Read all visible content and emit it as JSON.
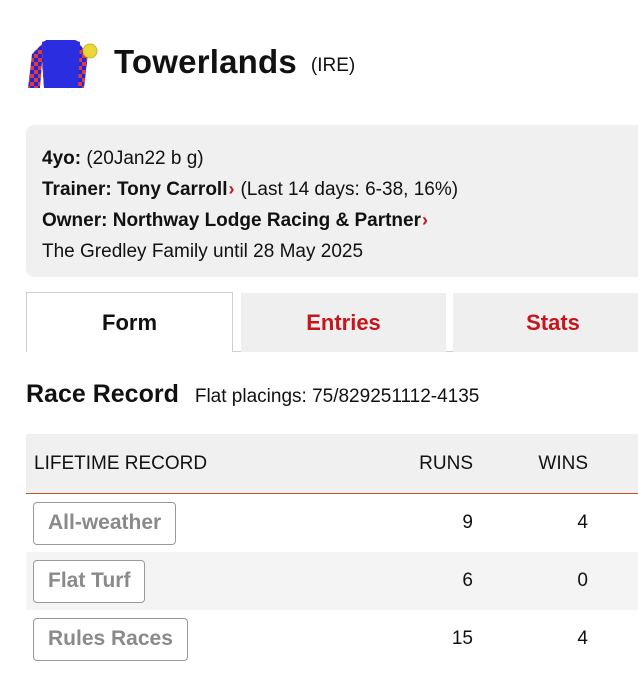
{
  "horse": {
    "name": "Towerlands",
    "country": "(IRE)",
    "silks": {
      "body_color": "#2b2ee0",
      "sleeve_color": "#e03a3a",
      "sleeve_check_color": "#1f28d8",
      "cap_color": "#e8d63a"
    }
  },
  "info": {
    "age_label": "4yo:",
    "age_value": "(20Jan22 b g)",
    "trainer_label": "Trainer:",
    "trainer_name": "Tony Carroll",
    "trainer_stats": "(Last 14 days: 6-38, 16%)",
    "owner_label": "Owner:",
    "owner_name": "Northway Lodge Racing & Partner",
    "previous_owner": "The Gredley Family until 28 May 2025"
  },
  "tabs": [
    {
      "label": "Form",
      "active": true
    },
    {
      "label": "Entries",
      "active": false
    },
    {
      "label": "Stats",
      "active": false
    }
  ],
  "race_record": {
    "title": "Race Record",
    "placings": "Flat placings: 75/829251112-4135"
  },
  "lifetime_table": {
    "headers": {
      "name": "LIFETIME RECORD",
      "runs": "RUNS",
      "wins": "WINS"
    },
    "rows": [
      {
        "name": "All-weather",
        "runs": "9",
        "wins": "4"
      },
      {
        "name": "Flat Turf",
        "runs": "6",
        "wins": "0"
      },
      {
        "name": "Rules Races",
        "runs": "15",
        "wins": "4"
      }
    ]
  },
  "colors": {
    "accent_red": "#c4161c",
    "header_rule": "#b8552e"
  }
}
